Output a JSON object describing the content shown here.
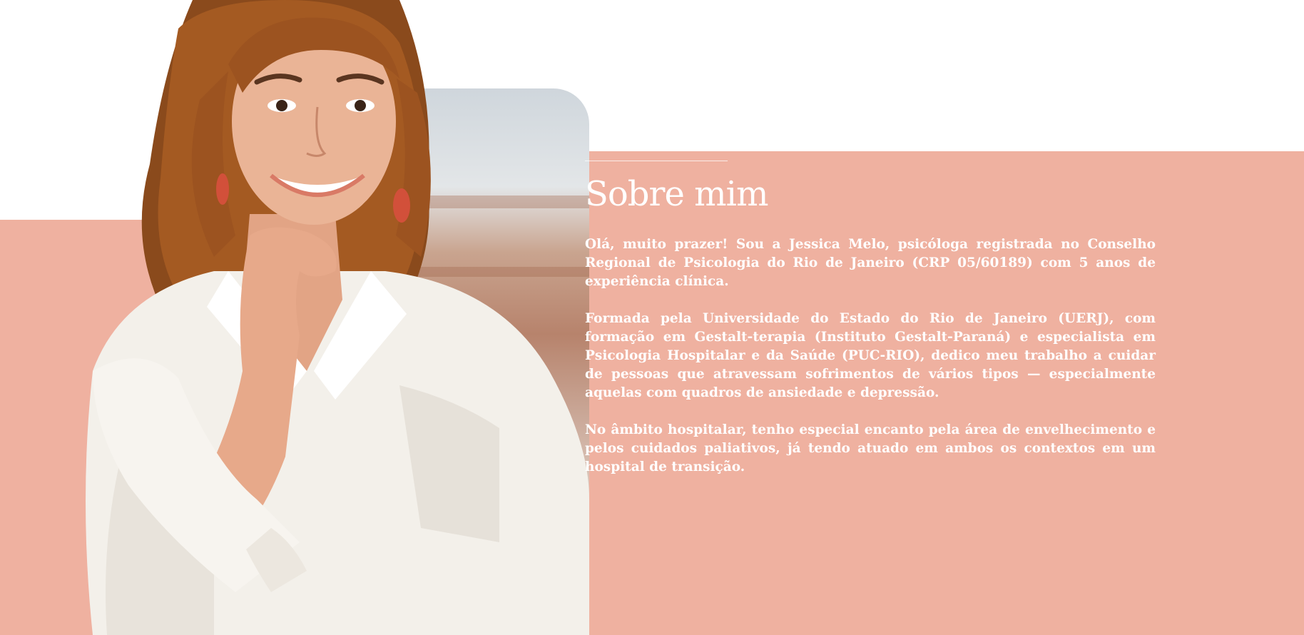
{
  "section": {
    "title": "Sobre mim",
    "paragraphs": [
      "Olá, muito prazer! Sou a Jessica Melo, psicóloga registrada no Conselho Regional de Psicologia do Rio de Janeiro (CRP 05/60189) com 5 anos de experiência clínica.",
      "Formada pela Universidade do Estado do Rio de Janeiro (UERJ), com formação em Gestalt-terapia (Instituto Gestalt-Paraná) e especialista em Psicologia Hospitalar e da Saúde (PUC-RIO), dedico meu trabalho a cuidar de pessoas que atravessam sofrimentos de vários tipos — especialmente aquelas com quadros de ansiedade e depressão.",
      "No âmbito hospitalar, tenho especial encanto pela área de envelhecimento e pelos cuidados paliativos, já tendo atuado em ambos os contextos em um hospital de transição."
    ]
  },
  "colors": {
    "accent": "#efb1a0",
    "background": "#ffffff",
    "text": "#ffffff"
  }
}
